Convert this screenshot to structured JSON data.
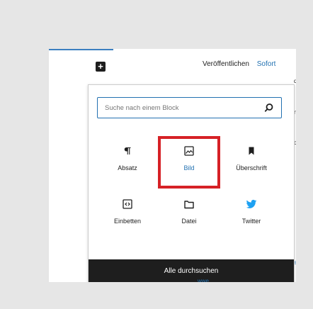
{
  "editor": {
    "add_block_glyph": "+",
    "publish_label": "Veröffentlichen",
    "publish_timing": "Sofort",
    "sidebar_fragments": [
      "da",
      "rts",
      "or",
      "er"
    ],
    "bottom_fragment": "wwe"
  },
  "inserter": {
    "search": {
      "placeholder": "Suche nach einem Block",
      "value": ""
    },
    "blocks": [
      {
        "label": "Absatz",
        "icon": "paragraph-icon"
      },
      {
        "label": "Bild",
        "icon": "image-icon",
        "active": true
      },
      {
        "label": "Überschrift",
        "icon": "bookmark-icon"
      },
      {
        "label": "Einbetten",
        "icon": "embed-icon"
      },
      {
        "label": "Datei",
        "icon": "folder-icon"
      },
      {
        "label": "Twitter",
        "icon": "twitter-icon"
      }
    ],
    "browse_all_label": "Alle durchsuchen"
  },
  "colors": {
    "accent_blue": "#2271b1",
    "highlight_red": "#d62126",
    "dark": "#1e1e1e",
    "twitter_blue": "#1da1f2"
  }
}
